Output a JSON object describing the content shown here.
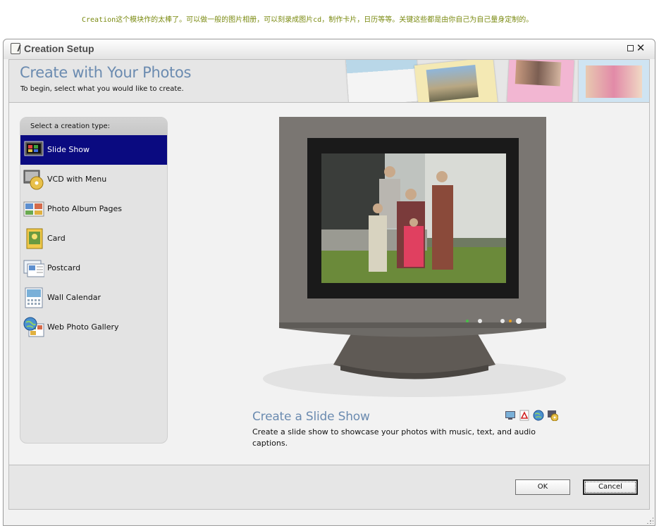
{
  "caption": "Creation这个模块作的太棒了。可以做一般的图片相册，可以刻录成图片cd，制作卡片，日历等等。关键这些都是由你自己为自己量身定制的。",
  "window": {
    "title": "Creation Setup",
    "maximize_icon": "maximize-icon",
    "close_glyph": "✕"
  },
  "header": {
    "title": "Create with Your Photos",
    "subtitle": "To begin, select what you would like to create."
  },
  "sidebar": {
    "heading": "Select a creation type:",
    "selected_index": 0,
    "items": [
      {
        "label": "Slide Show",
        "icon": "slideshow-icon"
      },
      {
        "label": "VCD with Menu",
        "icon": "vcd-disc-icon"
      },
      {
        "label": "Photo Album Pages",
        "icon": "photo-album-icon"
      },
      {
        "label": "Card",
        "icon": "card-icon"
      },
      {
        "label": "Postcard",
        "icon": "postcard-icon"
      },
      {
        "label": "Wall Calendar",
        "icon": "calendar-icon"
      },
      {
        "label": "Web Photo Gallery",
        "icon": "web-gallery-icon"
      }
    ]
  },
  "preview": {
    "title": "Create a Slide Show",
    "description": "Create a slide show to showcase your photos with music, text, and audio captions.",
    "output_icons": [
      "screen-output-icon",
      "pdf-output-icon",
      "web-output-icon",
      "disc-output-icon"
    ]
  },
  "footer": {
    "ok_label": "OK",
    "cancel_label": "Cancel"
  },
  "colors": {
    "accent_title": "#6b8bb0",
    "selection": "#0a0a80",
    "caption": "#7a8a10"
  }
}
